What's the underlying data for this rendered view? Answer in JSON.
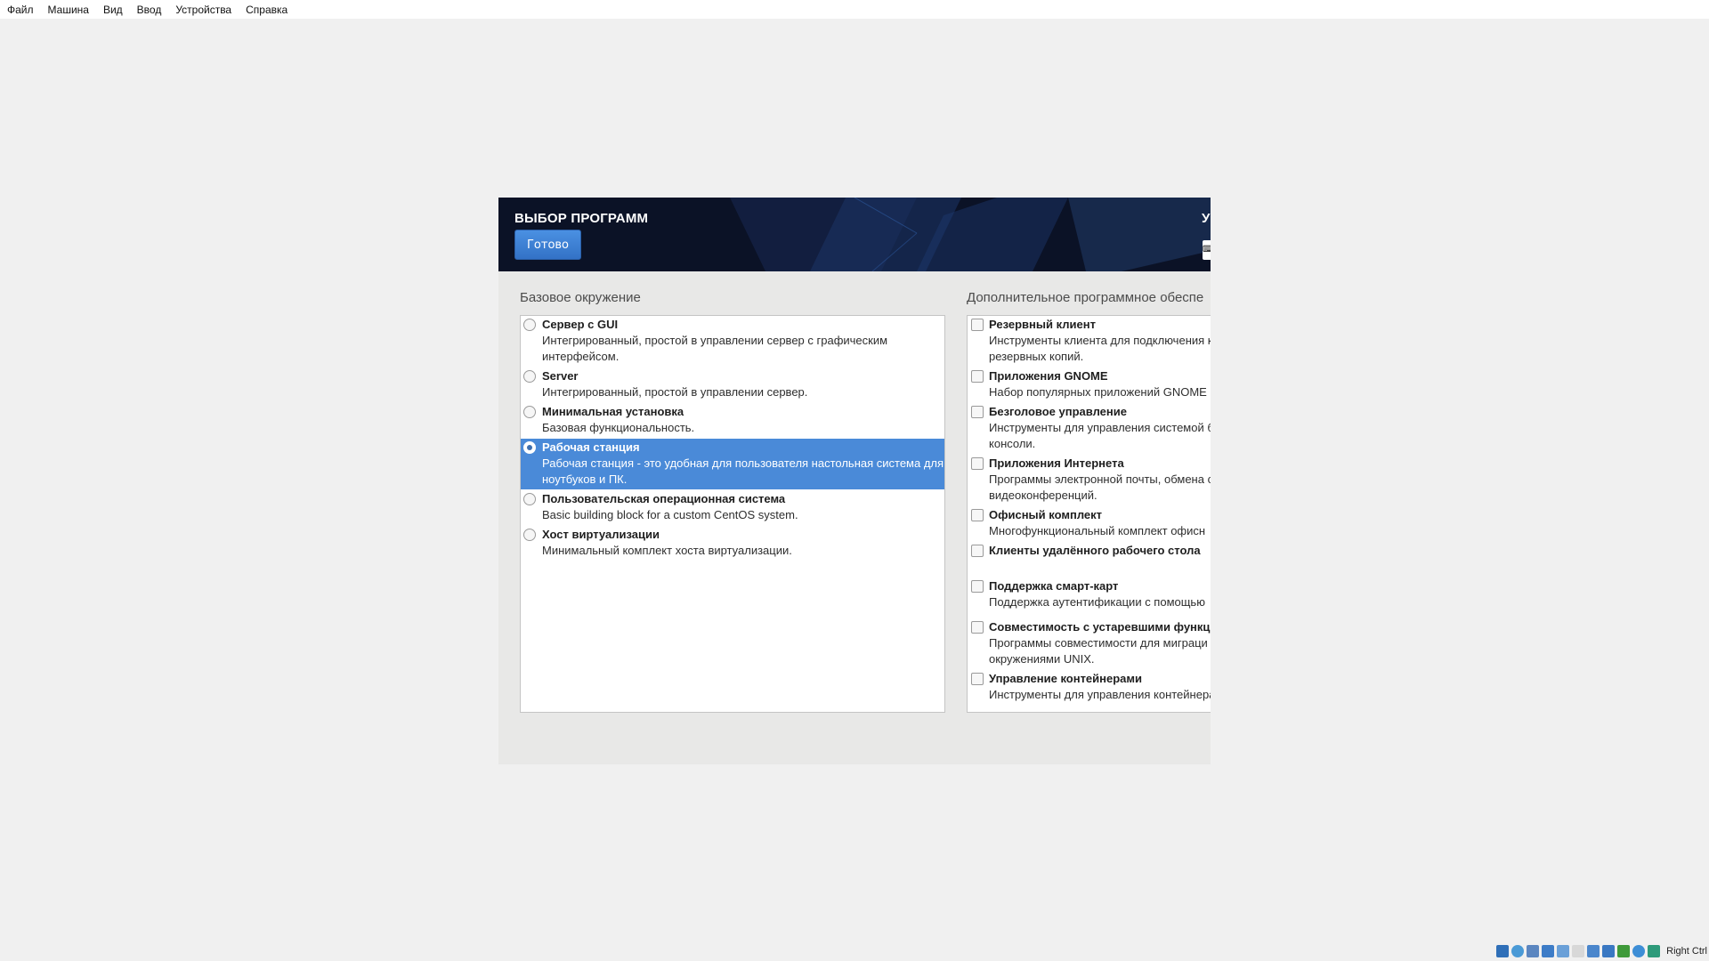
{
  "menubar": {
    "items": [
      "Файл",
      "Машина",
      "Вид",
      "Ввод",
      "Устройства",
      "Справка"
    ]
  },
  "header": {
    "title": "ВЫБОР ПРОГРАММ",
    "done_label": "Готово",
    "right_letter": "У",
    "right_kbd": "⌨"
  },
  "base_env": {
    "label": "Базовое окружение",
    "items": [
      {
        "title": "Сервер с GUI",
        "desc": [
          "Интегрированный, простой в управлении сервер с графическим",
          "интерфейсом."
        ],
        "selected": false
      },
      {
        "title": "Server",
        "desc": [
          "Интегрированный, простой в управлении сервер."
        ],
        "selected": false
      },
      {
        "title": "Минимальная установка",
        "desc": [
          "Базовая функциональность."
        ],
        "selected": false
      },
      {
        "title": "Рабочая станция",
        "desc": [
          "Рабочая станция - это удобная для пользователя настольная система для",
          "ноутбуков и ПК."
        ],
        "selected": true
      },
      {
        "title": "Пользовательская операционная система",
        "desc": [
          "Basic building block for a custom CentOS system."
        ],
        "selected": false
      },
      {
        "title": "Хост виртуализации",
        "desc": [
          "Минимальный комплект хоста виртуализации."
        ],
        "selected": false
      }
    ]
  },
  "addons": {
    "label": "Дополнительное программное обеспе",
    "items": [
      {
        "title": "Резервный клиент",
        "desc": [
          "Инструменты клиента для подключения к",
          "резервных копий."
        ]
      },
      {
        "title": "Приложения GNOME",
        "desc": [
          "Набор популярных приложений GNOME"
        ]
      },
      {
        "title": "Безголовое управление",
        "desc": [
          "Инструменты для управления системой б",
          "консоли."
        ]
      },
      {
        "title": "Приложения Интернета",
        "desc": [
          "Программы электронной почты, обмена с",
          "видеоконференций."
        ]
      },
      {
        "title": "Офисный комплект",
        "desc": [
          "Многофункциональный комплект офисн"
        ]
      },
      {
        "title": "Клиенты удалённого рабочего стола",
        "desc": []
      },
      {
        "title": "Поддержка смарт-карт",
        "desc": [
          "Поддержка аутентификации с помощью"
        ]
      },
      {
        "title": "Совместимость с устаревшими функци",
        "desc": [
          "Программы совместимости для миграци",
          "окружениями UNIX."
        ]
      },
      {
        "title": "Управление контейнерами",
        "desc": [
          "Инструменты для управления контейнера"
        ]
      }
    ]
  },
  "statusbar": {
    "host_key": "Right Ctrl"
  },
  "colors": {
    "selection": "#4a8ad8",
    "button": "#3b7fd4",
    "banner": "#0b1226"
  }
}
